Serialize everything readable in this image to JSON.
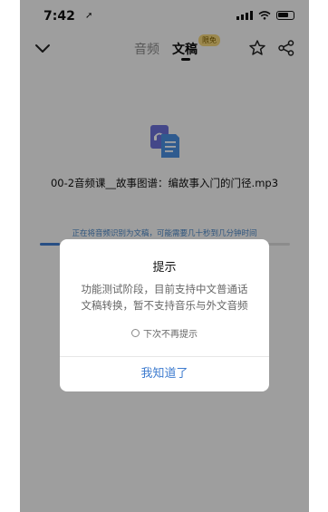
{
  "status_bar": {
    "time": "7:42",
    "location_arrow": "➚"
  },
  "nav": {
    "tab_audio": "音频",
    "tab_text": "文稿",
    "badge": "限免",
    "icons": [
      "back-chevron-icon",
      "star-icon",
      "share-icon"
    ]
  },
  "file": {
    "title": "00-2音频课__故事图谱：编故事入门的门径.mp3",
    "icon": "audio-document-icon"
  },
  "progress": {
    "hint": "正在将音频识别为文稿，可能需要几十秒到几分钟时间",
    "fraction": 0.08
  },
  "dialog": {
    "title": "提示",
    "message_line1": "功能测试阶段，目前支持中文普通话",
    "message_line2": "文稿转换，暂不支持音乐与外文音频",
    "checkbox_label": "下次不再提示",
    "confirm_button": "我知道了"
  },
  "colors": {
    "accent": "#3f7ccf",
    "badge_bg": "#f2d57a",
    "overlay": "rgba(0,0,0,0.36)"
  }
}
